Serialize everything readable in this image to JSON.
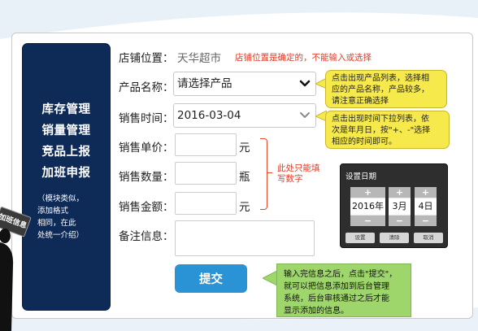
{
  "sidebar": {
    "menu": [
      "库存管理",
      "销量管理",
      "竞品上报",
      "加班申报"
    ],
    "note": [
      "（模块类似，",
      "添加格式",
      "相同，在此",
      "处统一介绍）"
    ],
    "tag_banner": "加班信息"
  },
  "form": {
    "store_label": "店铺位置：",
    "store_value": "天华超市",
    "store_note": "店铺位置是确定的，不能输入或选择",
    "product_label": "产品名称：",
    "product_value": "请选择产品",
    "date_label": "销售时间：",
    "date_value": "2016-03-04",
    "unit_price_label": "销售单价：",
    "unit_price_unit": "元",
    "quantity_label": "销售数量：",
    "quantity_unit": "瓶",
    "amount_label": "销售金额：",
    "amount_unit": "元",
    "remarks_label": "备注信息：",
    "bracket_note": [
      "此处只能填",
      "写数字"
    ],
    "submit_label": "提交"
  },
  "callouts": {
    "product": [
      "点击出现产品列表，选择相",
      "应的产品名称，产品较多，",
      "请注意正确选择"
    ],
    "date": [
      "点击出现时间下拉列表，依",
      "次是年月日，按\"+、-\"选择",
      "相应的时间即可。"
    ],
    "submit": [
      "输入完信息之后，点击\"提交\"，",
      "就可以把信息添加到后台管理",
      "系统，后台审核通过之后才能",
      "显示添加的信息。"
    ]
  },
  "date_picker": {
    "title": "设置日期",
    "plus": "+",
    "minus": "−",
    "year": "2016年",
    "month": "3月",
    "day": "4日",
    "actions": [
      "设置",
      "清除",
      "取消"
    ]
  },
  "colors": {
    "sidebar_bg": "#0e2a57",
    "accent_blue": "#2a93d5",
    "note_red": "#e03c2a",
    "callout_yellow": "#f6e94b",
    "callout_green": "#9ed66b"
  },
  "icons": {
    "product_dropdown": "chevron-down-icon",
    "date_dropdown": "chevron-down-icon"
  }
}
